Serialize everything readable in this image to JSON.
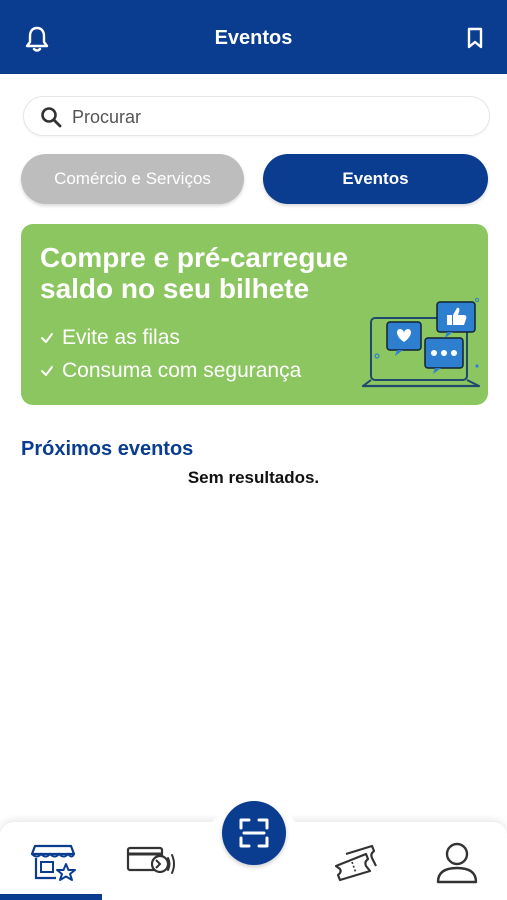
{
  "header": {
    "title": "Eventos",
    "left_icon": "bell-icon",
    "right_icon": "bookmark-icon"
  },
  "search": {
    "placeholder": "Procurar",
    "value": ""
  },
  "segments": {
    "items": [
      {
        "label": "Comércio e Serviços",
        "selected": false
      },
      {
        "label": "Eventos",
        "selected": true
      }
    ]
  },
  "banner": {
    "headline": "Compre e pré-carregue saldo no seu bilhete",
    "features": [
      "Evite as filas",
      "Consuma com segurança"
    ]
  },
  "section": {
    "title": "Próximos eventos",
    "empty_text": "Sem resultados."
  },
  "bottom_nav": {
    "items": [
      {
        "icon": "store-star-icon",
        "active": true
      },
      {
        "icon": "card-nfc-icon",
        "active": false
      },
      {
        "icon": "qr-scan-icon",
        "active": false
      },
      {
        "icon": "tickets-icon",
        "active": false
      },
      {
        "icon": "user-icon",
        "active": false
      }
    ]
  },
  "colors": {
    "primary": "#0a3d8f",
    "banner": "#8cc660",
    "segment_inactive": "#bdbdbd"
  }
}
